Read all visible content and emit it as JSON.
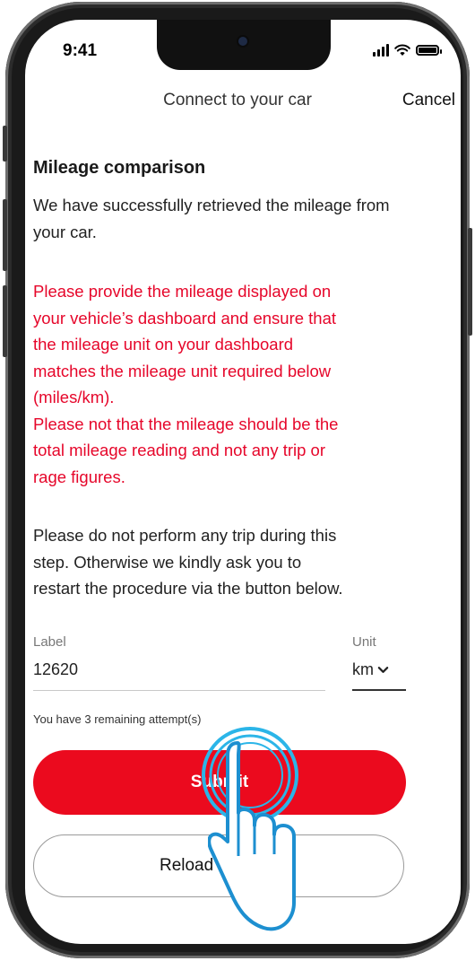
{
  "status_bar": {
    "time": "9:41"
  },
  "nav": {
    "title": "Connect to your car",
    "cancel_label": "Cancel"
  },
  "main": {
    "heading": "Mileage comparison",
    "intro": "We have successfully retrieved the mileage from your car.",
    "warning_lines": [
      "Please provide the mileage displayed on",
      "your vehicle’s dashboard and ensure that",
      "the mileage unit on your dashboard",
      "matches the mileage unit required below",
      "(miles/km).",
      "Please not that the mileage should be the",
      "total mileage reading and not any trip or",
      "rage figures."
    ],
    "notice_lines": [
      "Please do not perform any trip during this",
      "step. Otherwise we kindly ask you to",
      "restart the procedure via the button below."
    ]
  },
  "form": {
    "label_field": {
      "label": "Label",
      "value": "12620"
    },
    "unit_field": {
      "label": "Unit",
      "value": "km"
    },
    "attempts_text": "You have 3 remaining attempt(s)"
  },
  "actions": {
    "submit_label": "Submit",
    "reload_label": "Reload mileage"
  },
  "colors": {
    "accent": "#eb0a1e",
    "tap_ring": "#2bb5e8"
  },
  "icons": [
    "signal-icon",
    "wifi-icon",
    "battery-icon",
    "chevron-down-icon",
    "hand-pointer-icon"
  ]
}
